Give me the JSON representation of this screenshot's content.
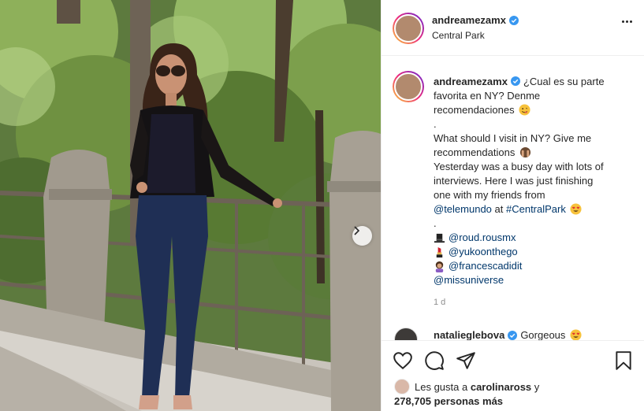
{
  "post": {
    "username": "andreamezamx",
    "location": "Central Park",
    "caption": {
      "lines": [
        "¿Cual es su parte",
        "favorita en NY? Denme",
        "recomendaciones",
        ".",
        "What should I visit in NY? Give me",
        "recommendations",
        "Yesterday was a busy day with lots of",
        "interviews. Here I was just finishing",
        "one with my friends from"
      ],
      "mention_telemundo": "@telemundo",
      "at_word": " at ",
      "hashtag": "#CentralPark",
      "dot": ".",
      "credits": [
        {
          "icon": "top-hat-icon",
          "handle": "@roud.rousmx"
        },
        {
          "icon": "lipstick-icon",
          "handle": "@yukoonthego"
        },
        {
          "icon": "hairdresser-icon",
          "handle": "@francescadidit"
        }
      ],
      "mention_missuniverse": "@missuniverse"
    },
    "time_ago": "1 d",
    "comment": {
      "username": "natalieglebova",
      "text": "Gorgeous"
    },
    "likes": {
      "prefix": "Les gusta a",
      "user": "carolinaross",
      "conj": "y",
      "count": "278,705 personas más"
    }
  },
  "colors": {
    "verified": "#3897f0",
    "link": "#00376b",
    "muted": "#8e8e8e",
    "border": "#efefef"
  },
  "icons": [
    "more-options-icon",
    "heart-icon",
    "comment-icon",
    "share-icon",
    "bookmark-icon",
    "next-arrow-icon",
    "verified-icon"
  ]
}
